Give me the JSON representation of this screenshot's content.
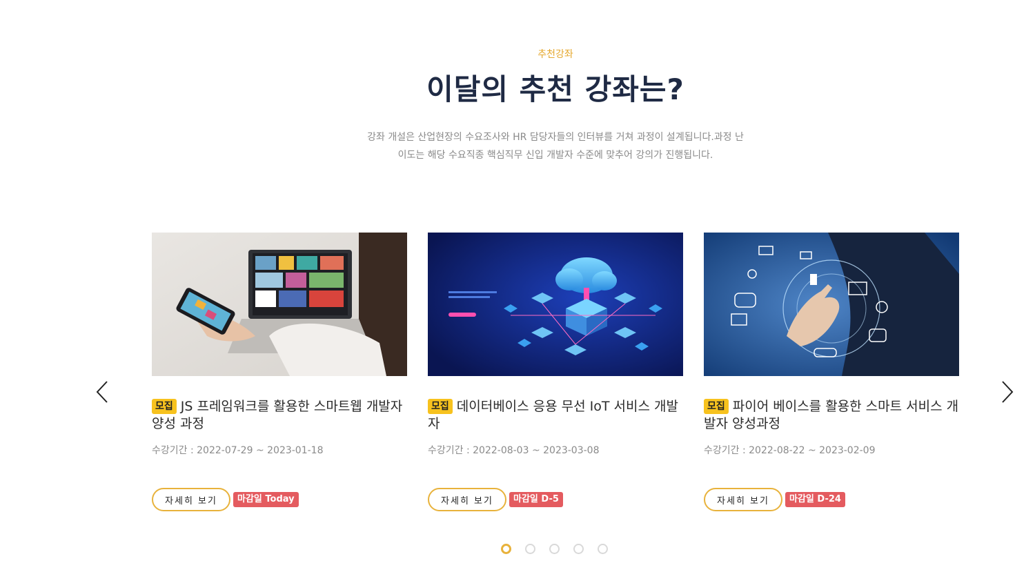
{
  "section": {
    "eyebrow": "추천강좌",
    "headline": "이달의 추천 강좌는?",
    "description": "강좌 개설은 산업현장의 수요조사와 HR 담당자들의 인터뷰를 거쳐 과정이 설계됩니다.과정 난이도는 해당 수요직종 핵심직무 신입 개발자 수준에 맞추어 강의가 진행됩니다."
  },
  "carousel": {
    "prev_icon": "chevron-left-icon",
    "next_icon": "chevron-right-icon",
    "cards": [
      {
        "status": "모집",
        "title": "JS 프레임워크를 활용한 스마트웹 개발자 양성 과정",
        "period": "수강기간 : 2022-07-29 ~ 2023-01-18",
        "detail_label": "자세히 보기",
        "deadline": "마감일 Today",
        "image": "woman-using-smartphone-laptop-photo"
      },
      {
        "status": "모집",
        "title": "데이터베이스 응용 무선 IoT 서비스 개발자",
        "period": "수강기간 : 2022-08-03 ~ 2023-03-08",
        "detail_label": "자세히 보기",
        "deadline": "마감일 D-5",
        "image": "cloud-server-room-illustration"
      },
      {
        "status": "모집",
        "title": "파이어 베이스를 활용한 스마트 서비스 개발자 양성과정",
        "period": "수강기간 : 2022-08-22 ~ 2023-02-09",
        "detail_label": "자세히 보기",
        "deadline": "마감일 D-24",
        "image": "businessman-touching-network-icons-photo"
      }
    ],
    "pagination": {
      "total": 5,
      "active": 1
    }
  },
  "colors": {
    "accent": "#e8b23b",
    "badge": "#f7c21e",
    "deadline": "#e45b5f",
    "heading": "#1f2a44"
  }
}
